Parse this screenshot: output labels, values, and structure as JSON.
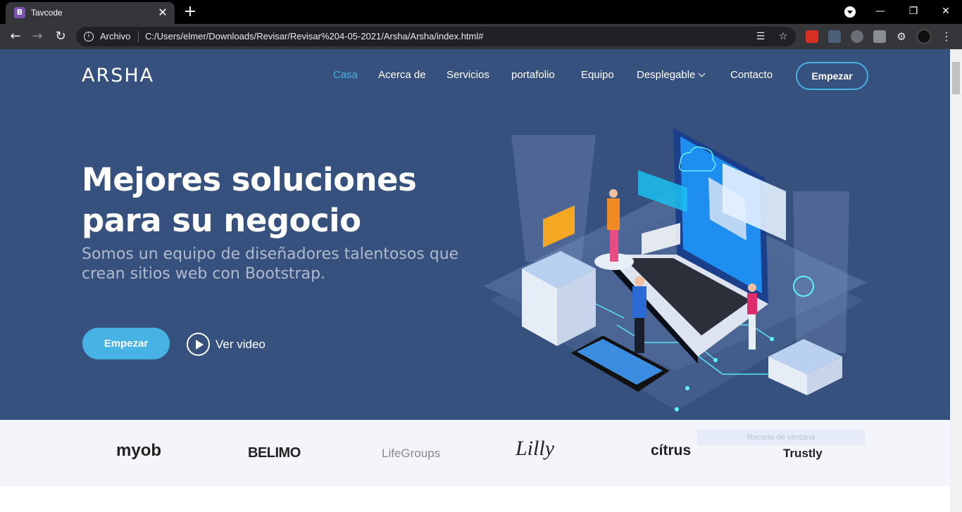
{
  "browser": {
    "tab_title": "Tavcode",
    "tab_favicon": "B",
    "omnibox_label": "Archivo",
    "url": "C:/Users/elmer/Downloads/Revisar/Revisar%204-05-2021/Arsha/Arsha/index.html#"
  },
  "site": {
    "logo": "ARSHA",
    "nav": [
      {
        "label": "Casa"
      },
      {
        "label": "Acerca de"
      },
      {
        "label": "Servicios"
      },
      {
        "label": "portafolio"
      },
      {
        "label": "Equipo"
      },
      {
        "label": "Desplegable"
      },
      {
        "label": "Contacto"
      }
    ],
    "nav_button": "Empezar",
    "accent": "#47b2e4",
    "hero_bg": "#37517e"
  },
  "hero": {
    "title": "Mejores soluciones para su negocio",
    "subtitle": "Somos un equipo de diseñadores talentosos que crean sitios web con Bootstrap.",
    "start_button": "Empezar",
    "video_link": "Ver video"
  },
  "clients": {
    "logos": [
      "myob",
      "BELIMO",
      "LifeGroups",
      "Lilly",
      "cítrus",
      "Trustly"
    ],
    "overlay_text": "Recorte de ventana"
  }
}
